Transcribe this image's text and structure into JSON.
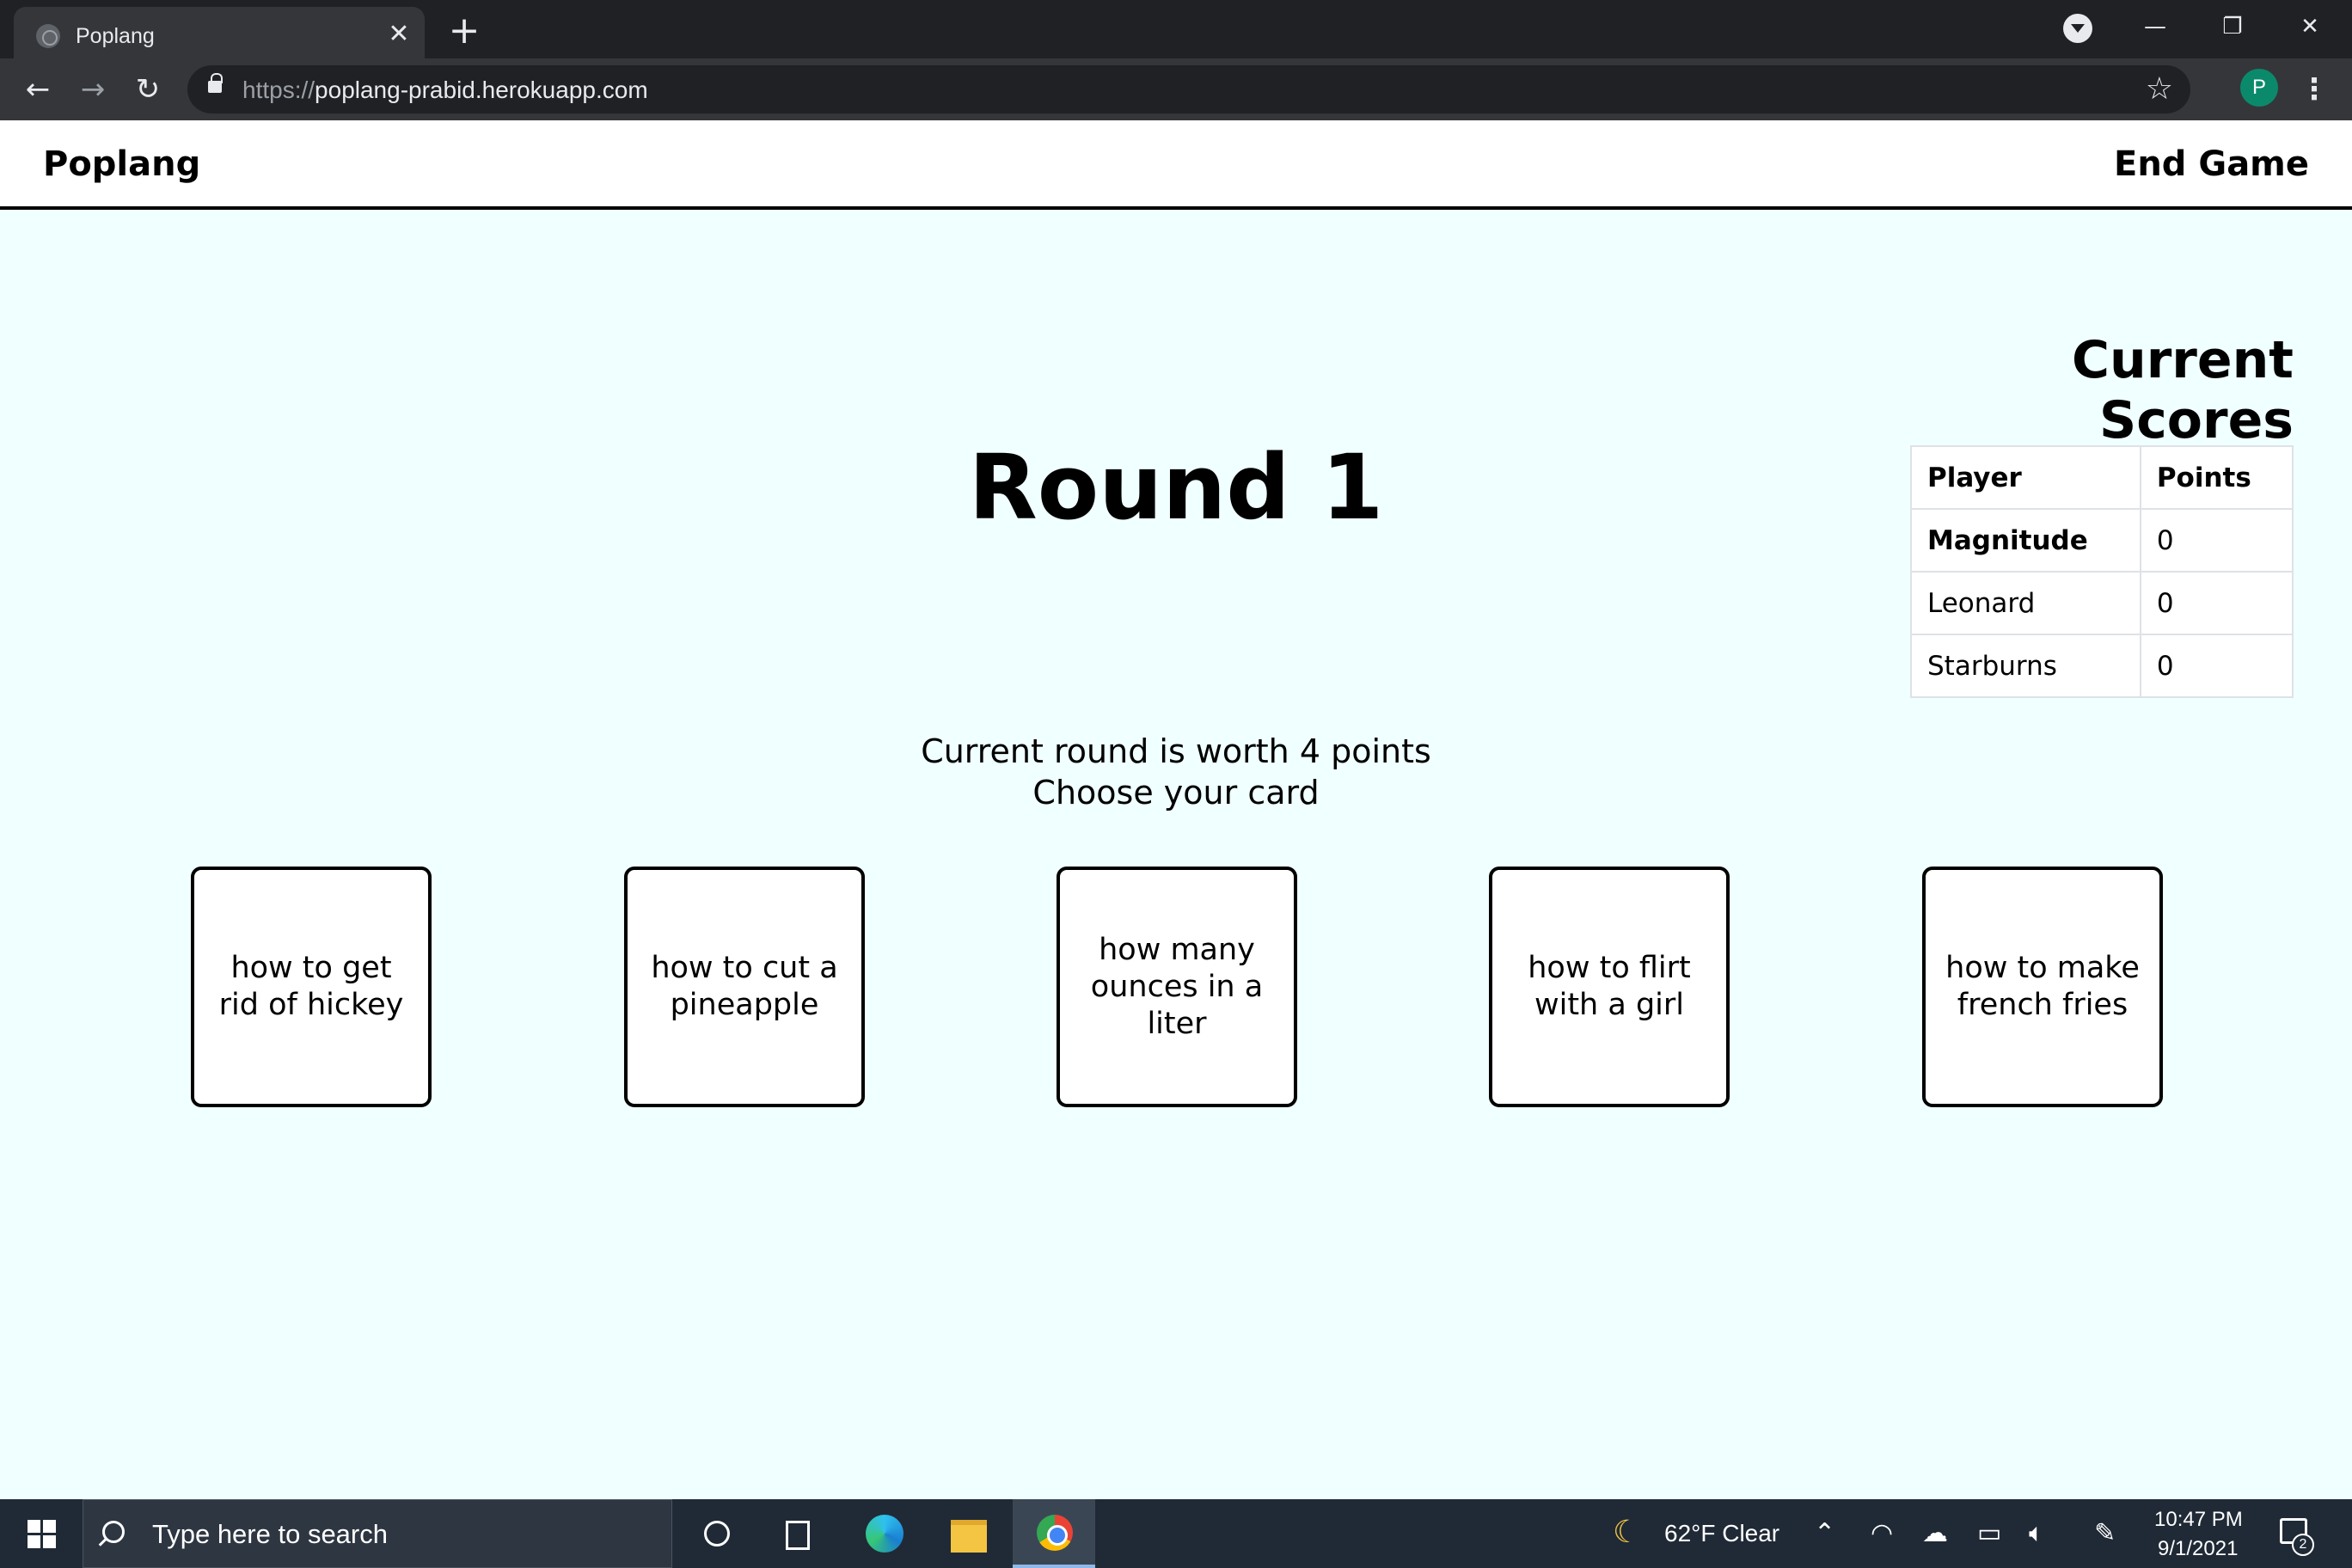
{
  "browser": {
    "tab_title": "Poplang",
    "tab_close": "✕",
    "new_tab": "+",
    "url_scheme": "https://",
    "url_host": "poplang-prabid.herokuapp.com",
    "profile_initial": "P",
    "window_controls": {
      "minimize": "—",
      "restore": "❐",
      "close": "✕"
    },
    "nav": {
      "back": "←",
      "forward": "→",
      "reload": "↻"
    },
    "star": "☆",
    "menu": "⋮"
  },
  "navbar": {
    "brand": "Poplang",
    "end_game": "End Game"
  },
  "game": {
    "round_title": "Round 1",
    "worth_text": "Current round is worth 4 points",
    "instruction": "Choose your card",
    "cards": [
      "how to get rid of hickey",
      "how to cut a pineapple",
      "how many ounces in a liter",
      "how to flirt with a girl",
      "how to make french fries"
    ]
  },
  "scores": {
    "heading": "Current Scores",
    "columns": [
      "Player",
      "Points"
    ],
    "rows": [
      {
        "player": "Magnitude",
        "points": "0"
      },
      {
        "player": "Leonard",
        "points": "0"
      },
      {
        "player": "Starburns",
        "points": "0"
      }
    ]
  },
  "taskbar": {
    "search_placeholder": "Type here to search",
    "weather_icon": "moon-icon",
    "weather": "62°F  Clear",
    "time": "10:47 PM",
    "date": "9/1/2021",
    "notification_count": "2"
  },
  "colors": {
    "page_background": "#f0ffff",
    "browser_frame": "#202124",
    "taskbar": "#202a36",
    "profile_avatar": "#0b8a6b"
  }
}
